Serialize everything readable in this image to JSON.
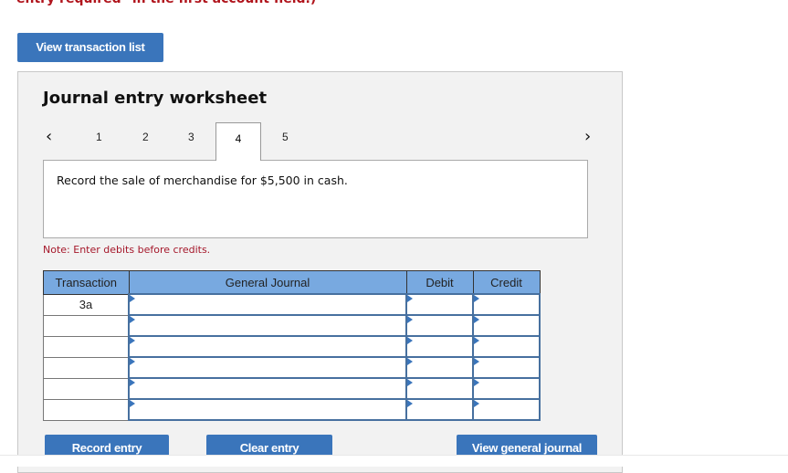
{
  "top_instruction": "entry required\" in the first account field.)",
  "buttons": {
    "view_transaction_list": "View transaction list",
    "record_entry": "Record entry",
    "clear_entry": "Clear entry",
    "view_general_journal": "View general journal"
  },
  "worksheet": {
    "title": "Journal entry worksheet",
    "prev_icon": "‹",
    "next_icon": "›",
    "tabs": [
      "1",
      "2",
      "3",
      "4",
      "5"
    ],
    "active_tab": "4",
    "prompt": "Record the sale of merchandise for $5,500 in cash.",
    "note": "Note: Enter debits before credits."
  },
  "table": {
    "headers": [
      "Transaction",
      "General Journal",
      "Debit",
      "Credit"
    ],
    "rows": [
      {
        "transaction": "3a",
        "account": "",
        "debit": "",
        "credit": ""
      },
      {
        "transaction": "",
        "account": "",
        "debit": "",
        "credit": ""
      },
      {
        "transaction": "",
        "account": "",
        "debit": "",
        "credit": ""
      },
      {
        "transaction": "",
        "account": "",
        "debit": "",
        "credit": ""
      },
      {
        "transaction": "",
        "account": "",
        "debit": "",
        "credit": ""
      },
      {
        "transaction": "",
        "account": "",
        "debit": "",
        "credit": ""
      }
    ]
  },
  "colors": {
    "accent": "#3a75bb",
    "header_bg": "#78a9e0",
    "note_red": "#a5172a",
    "panel_bg": "#f2f2f2"
  }
}
